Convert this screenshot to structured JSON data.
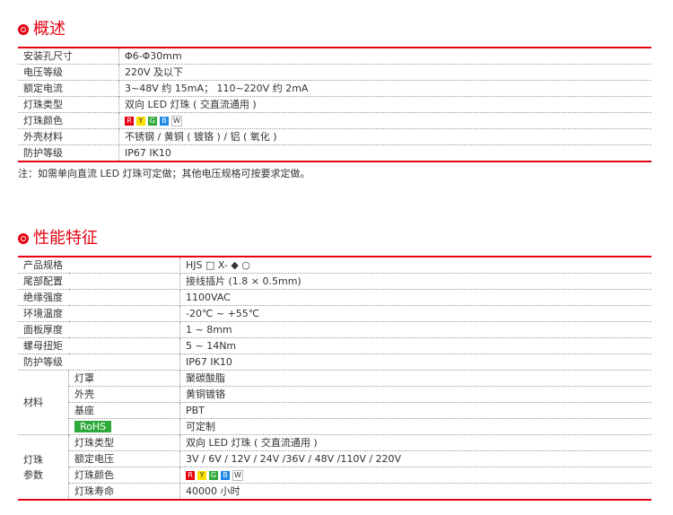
{
  "overview": {
    "title": "概述",
    "rows": [
      {
        "label": "安装孔尺寸",
        "value": "Φ6-Φ30mm"
      },
      {
        "label": "电压等级",
        "value": "220V 及以下"
      },
      {
        "label": "额定电流",
        "value": "3~48V 约 15mA；    110~220V 约 2mA"
      },
      {
        "label": "灯珠类型",
        "value": "双向 LED 灯珠 ( 交直流通用 )"
      },
      {
        "label": "灯珠颜色",
        "value": ""
      },
      {
        "label": "外壳材料",
        "value": "不锈钢 / 黄铜 ( 镀铬 ) / 铝 ( 氧化 )"
      },
      {
        "label": "防护等级",
        "value": "IP67  IK10"
      }
    ],
    "note": "注：如需单向直流 LED 灯珠可定做；其他电压规格可按要求定做。"
  },
  "colors": [
    {
      "letter": "R",
      "bg": "#e60012",
      "fg": "#ffffff"
    },
    {
      "letter": "Y",
      "bg": "#ffe100",
      "fg": "#333333"
    },
    {
      "letter": "G",
      "bg": "#2eaa3c",
      "fg": "#ffffff"
    },
    {
      "letter": "B",
      "bg": "#1e88e5",
      "fg": "#ffffff"
    },
    {
      "letter": "W",
      "bg": "#ffffff",
      "fg": "#333333"
    }
  ],
  "performance": {
    "title": "性能特征",
    "rows": [
      {
        "label": "产品规格",
        "value": "HJS □ X- ◆ ○"
      },
      {
        "label": "尾部配置",
        "value": "接线插片 (1.8 × 0.5mm)"
      },
      {
        "label": "绝缘强度",
        "value": "1100VAC"
      },
      {
        "label": "环境温度",
        "value": "-20℃ ~ +55℃"
      },
      {
        "label": "面板厚度",
        "value": "1 ~ 8mm"
      },
      {
        "label": "螺母扭矩",
        "value": "5 ~ 14Nm"
      },
      {
        "label": "防护等级",
        "value": "IP67  IK10"
      }
    ],
    "material_group": "材料",
    "material_rows": [
      {
        "label": "灯罩",
        "value": "聚碳酸脂"
      },
      {
        "label": "外壳",
        "value": "黄铜镀铬"
      },
      {
        "label": "基座",
        "value": "PBT"
      },
      {
        "label": "RoHS",
        "value": "可定制"
      }
    ],
    "lamp_group_1": "灯珠",
    "lamp_group_2": "参数",
    "lamp_rows": [
      {
        "label": "灯珠类型",
        "value": "双向 LED 灯珠 ( 交直流通用 )"
      },
      {
        "label": "额定电压",
        "value": "3V / 6V / 12V / 24V /36V / 48V /110V / 220V"
      },
      {
        "label": "灯珠颜色",
        "value": ""
      },
      {
        "label": "灯珠寿命",
        "value": "40000 小时"
      }
    ]
  }
}
